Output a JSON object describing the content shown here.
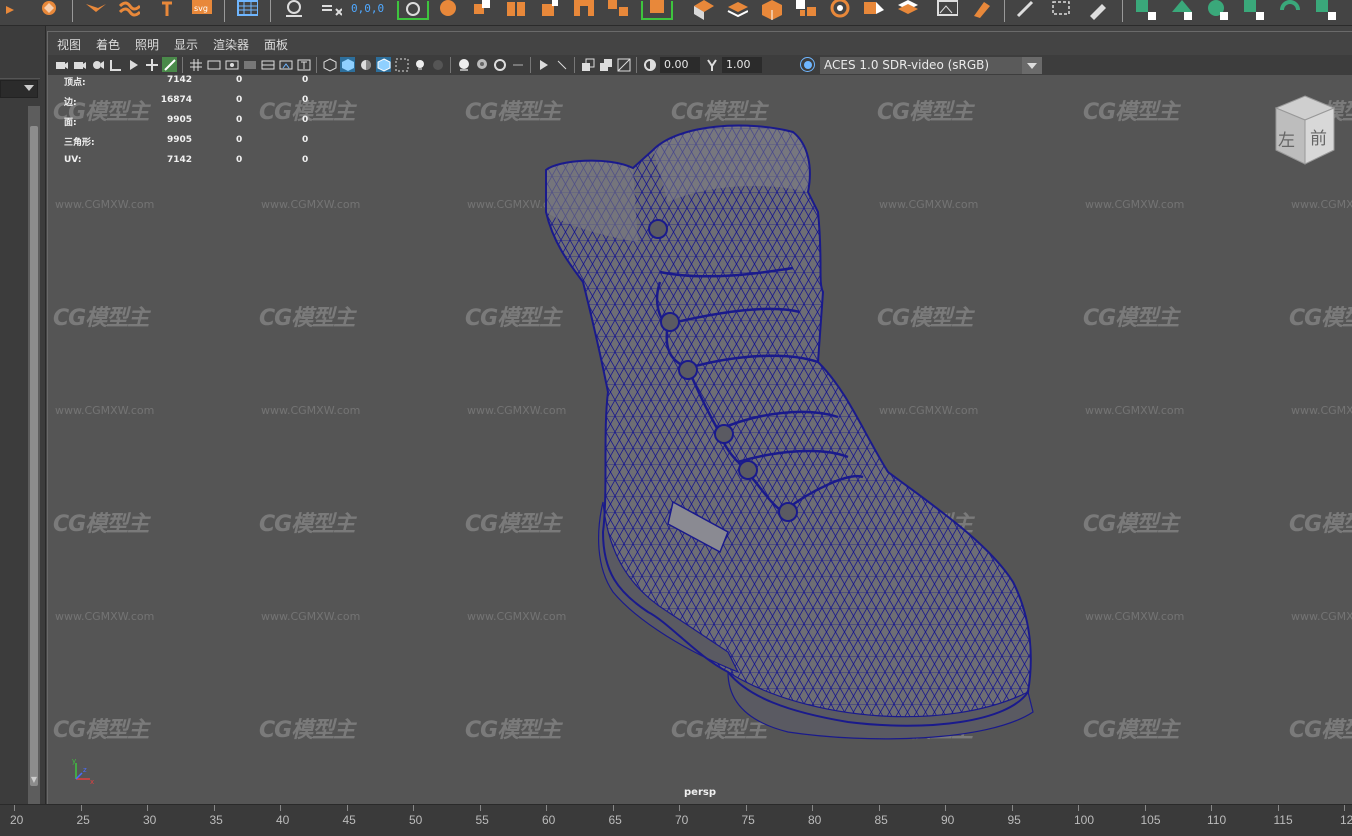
{
  "shelf": {
    "coord_readout": "0,0,0"
  },
  "panel_menu": {
    "items": [
      "视图",
      "着色",
      "照明",
      "显示",
      "渲染器",
      "面板"
    ]
  },
  "panel_toolbar": {
    "exposure_value": "0.00",
    "gamma_value": "1.00",
    "color_space": "ACES 1.0 SDR-video (sRGB)"
  },
  "hud": {
    "rows": [
      {
        "label": "顶点:",
        "v1": "7142",
        "v2": "0",
        "v3": "0"
      },
      {
        "label": "边:",
        "v1": "16874",
        "v2": "0",
        "v3": "0"
      },
      {
        "label": "面:",
        "v1": "9905",
        "v2": "0",
        "v3": "0"
      },
      {
        "label": "三角形:",
        "v1": "9905",
        "v2": "0",
        "v3": "0"
      },
      {
        "label": "UV:",
        "v1": "7142",
        "v2": "0",
        "v3": "0"
      }
    ]
  },
  "viewcube": {
    "left_face": "左",
    "front_face": "前"
  },
  "camera_label": "persp",
  "watermark": {
    "logo_text": "CG模型主",
    "url_text": "www.CGMXW.com"
  },
  "timeline": {
    "ticks": [
      "20",
      "25",
      "30",
      "35",
      "40",
      "45",
      "50",
      "55",
      "60",
      "65",
      "70",
      "75",
      "80",
      "85",
      "90",
      "95",
      "100",
      "105",
      "110",
      "115",
      "12"
    ]
  },
  "colors": {
    "viewport_bg": "#555555",
    "wireframe": "#1a1a8c",
    "shelf_accent": "#e8883a",
    "highlight_green": "#3ec43e"
  }
}
